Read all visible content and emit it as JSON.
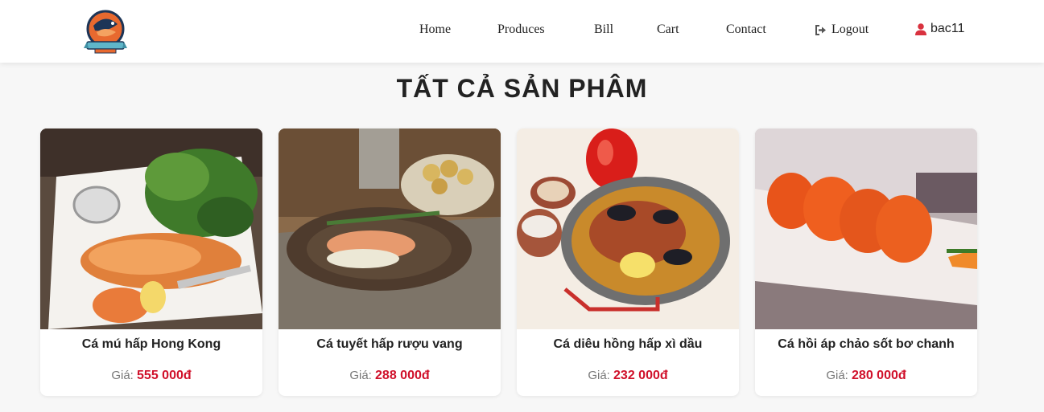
{
  "header": {
    "logo_alt": "Fishing logo",
    "nav": {
      "home": "Home",
      "produces": "Produces",
      "bill": "Bill",
      "cart": "Cart",
      "contact": "Contact",
      "logout": "Logout"
    },
    "user": {
      "name": "bac11"
    }
  },
  "main": {
    "title": "TẤT CẢ SẢN PHÂM",
    "products": [
      {
        "name": "Cá mú hấp Hong Kong",
        "price_label": "Giá:",
        "price": "555 000đ"
      },
      {
        "name": "Cá tuyết hấp rượu vang",
        "price_label": "Giá:",
        "price": "288 000đ"
      },
      {
        "name": "Cá diêu hồng hấp xì dầu",
        "price_label": "Giá:",
        "price": "232 000đ"
      },
      {
        "name": "Cá hồi áp chảo sốt bơ chanh",
        "price_label": "Giá:",
        "price": "280 000đ"
      }
    ]
  },
  "colors": {
    "price": "#d0102a",
    "user_icon": "#d9323f",
    "background": "#f7f7f7"
  },
  "icons": {
    "logout": "logout-icon",
    "user": "user-icon"
  }
}
